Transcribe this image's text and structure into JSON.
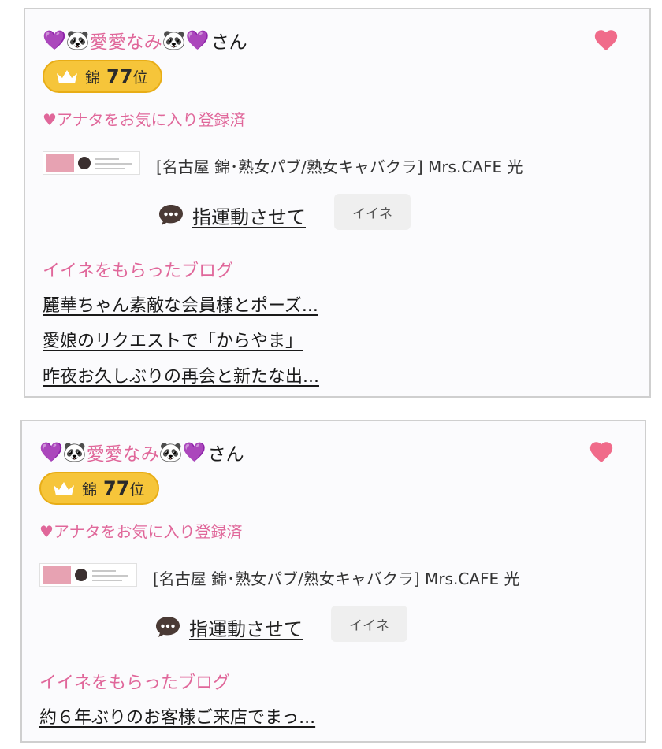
{
  "cards": [
    {
      "name": "愛愛なみ",
      "honorific": "さん",
      "rank": {
        "area": "錦",
        "number": "77",
        "suffix": "位"
      },
      "favorite_status": "♥アナタをお気に入り登録済",
      "shop": "[名古屋 錦･熟女パブ/熟女キャバクラ]  Mrs.CAFE 光",
      "comment": "指運動させて",
      "iine_label": "イイネ",
      "blog_heading": "イイネをもらったブログ",
      "blogs": [
        "麗華ちゃん素敵な会員様とポーズ...",
        "愛娘のリクエストで「からやま」",
        "昨夜お久しぶりの再会と新たな出..."
      ]
    },
    {
      "name": "愛愛なみ",
      "honorific": "さん",
      "rank": {
        "area": "錦",
        "number": "77",
        "suffix": "位"
      },
      "favorite_status": "♥アナタをお気に入り登録済",
      "shop": "[名古屋 錦･熟女パブ/熟女キャバクラ]  Mrs.CAFE 光",
      "comment": "指運動させて",
      "iine_label": "イイネ",
      "blog_heading": "イイネをもらったブログ",
      "blogs": [
        "約６年ぶりのお客様ご来店でまっ..."
      ]
    }
  ],
  "colors": {
    "accent_pink": "#e0679a",
    "heart": "#f06b8a",
    "badge_gold": "#f6c53a",
    "purple_heart": "#9b3fd6"
  },
  "icons": [
    "purple-heart-icon",
    "panda-icon",
    "favorite-heart-icon",
    "crown-icon",
    "comment-bubble-icon"
  ]
}
